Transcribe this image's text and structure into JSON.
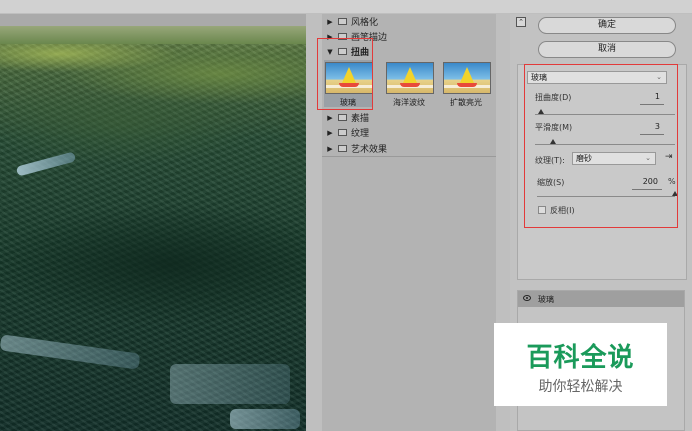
{
  "filter_gallery": {
    "folders_top": [
      {
        "label": "风格化",
        "expanded": false
      },
      {
        "label": "画笔描边",
        "expanded": false
      },
      {
        "label": "扭曲",
        "expanded": true
      }
    ],
    "thumbnails": [
      {
        "label": "玻璃",
        "selected": true
      },
      {
        "label": "海洋波纹",
        "selected": false
      },
      {
        "label": "扩散亮光",
        "selected": false
      }
    ],
    "folders_bottom": [
      {
        "label": "素描",
        "expanded": false
      },
      {
        "label": "纹理",
        "expanded": false
      },
      {
        "label": "艺术效果",
        "expanded": false
      }
    ]
  },
  "buttons": {
    "ok": "确定",
    "cancel": "取消"
  },
  "settings": {
    "filter_select": "玻璃",
    "distortion_label": "扭曲度(D)",
    "distortion_value": "1",
    "smoothness_label": "平滑度(M)",
    "smoothness_value": "3",
    "texture_label": "纹理(T):",
    "texture_value": "磨砂",
    "scale_label": "缩放(S)",
    "scale_value": "200",
    "scale_unit": "%",
    "invert_label": "反相(I)",
    "invert_checked": false
  },
  "layers": {
    "effect_layer": "玻璃"
  },
  "watermark": {
    "title": "百科全说",
    "subtitle": "助你轻松解决"
  },
  "colors": {
    "highlight_box": "#e23a3a",
    "watermark_green": "#1a9a5a"
  }
}
